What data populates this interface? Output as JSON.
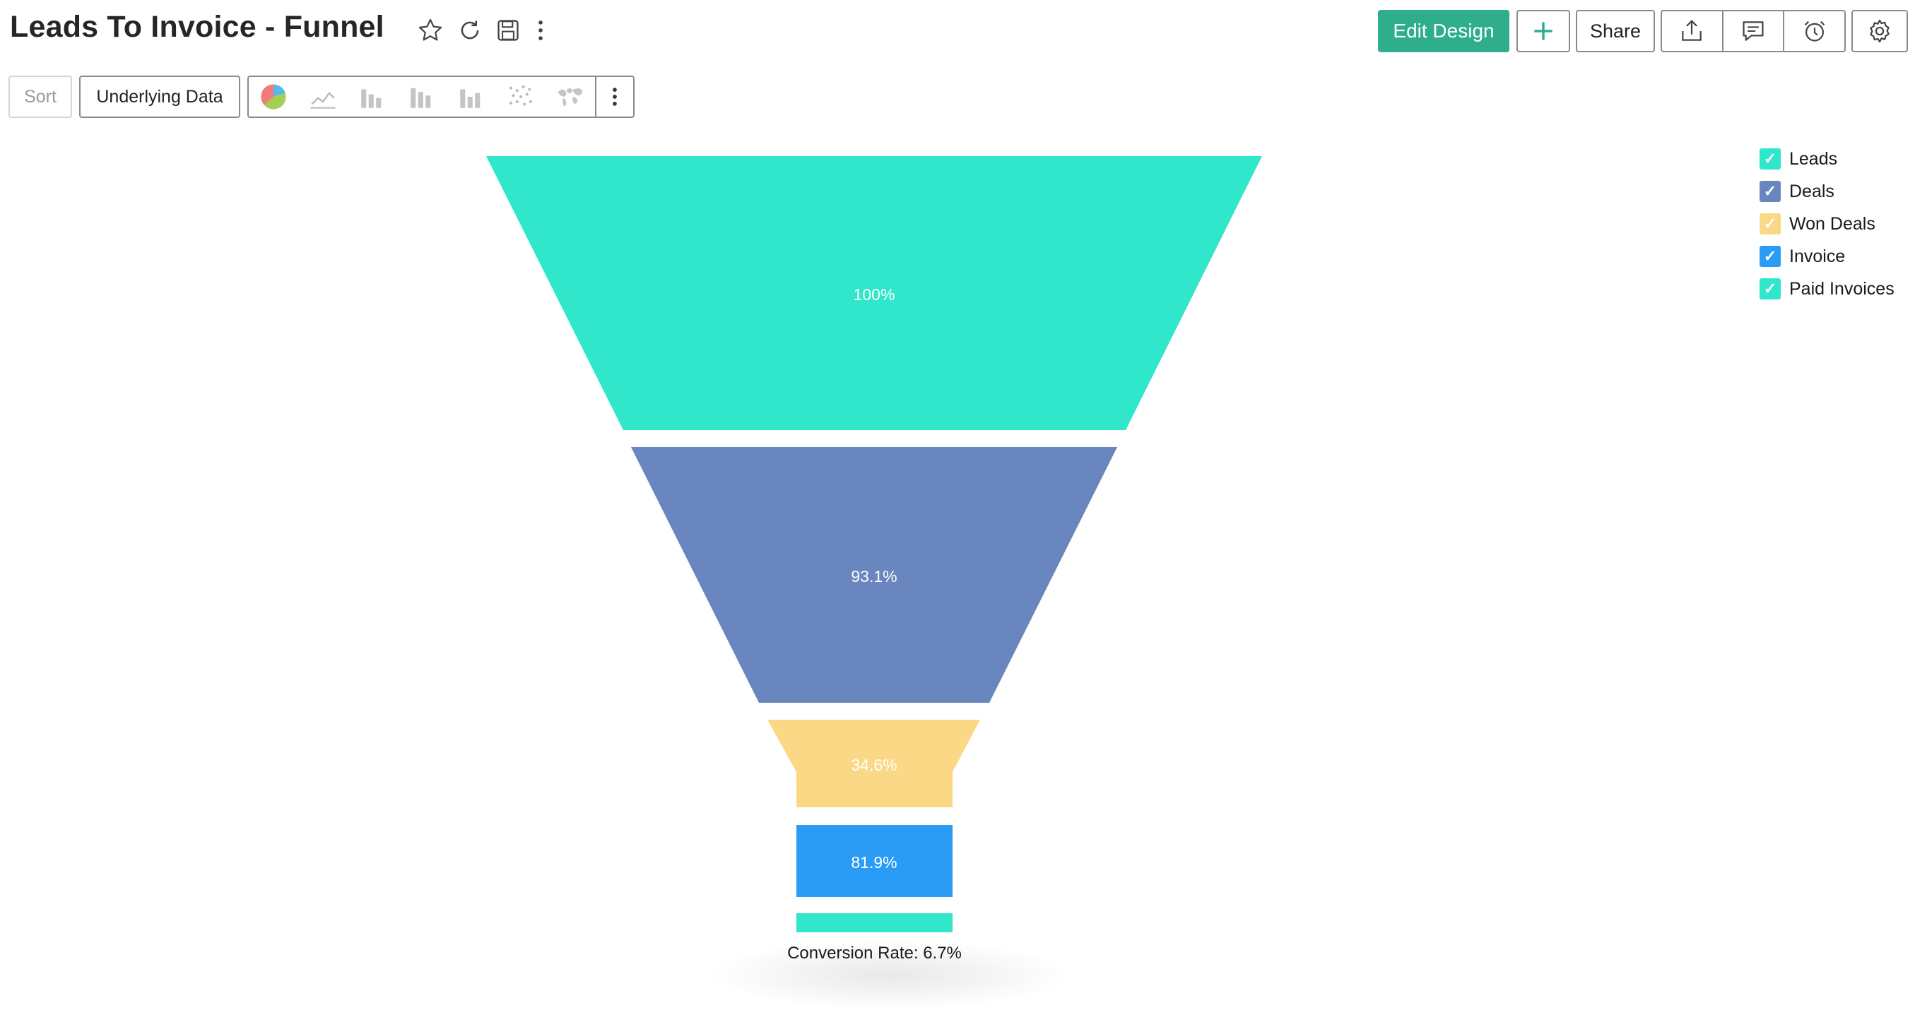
{
  "header": {
    "title": "Leads To Invoice - Funnel",
    "edit_design_label": "Edit Design",
    "share_label": "Share"
  },
  "toolbar": {
    "sort_label": "Sort",
    "underlying_data_label": "Underlying Data",
    "chart_type_icons": [
      "pie-chart-icon",
      "line-chart-icon",
      "bar-chart-icon",
      "stacked-bar-chart-icon",
      "combo-bar-chart-icon",
      "scatter-chart-icon",
      "map-chart-icon"
    ]
  },
  "colors": {
    "accent": "#2fae8e",
    "leads": "#30e6cb",
    "deals": "#6a86bf",
    "won_deals": "#fbd885",
    "invoice": "#2b9cf6",
    "paid_invoices": "#30e6cb"
  },
  "legend": {
    "items": [
      {
        "label": "Leads",
        "color": "#30e6cb",
        "checked": true
      },
      {
        "label": "Deals",
        "color": "#6a86bf",
        "checked": true
      },
      {
        "label": "Won Deals",
        "color": "#fbd885",
        "checked": true
      },
      {
        "label": "Invoice",
        "color": "#2b9cf6",
        "checked": true
      },
      {
        "label": "Paid Invoices",
        "color": "#30e6cb",
        "checked": true
      }
    ]
  },
  "chart_data": {
    "type": "funnel",
    "categories": [
      "Leads",
      "Deals",
      "Won Deals",
      "Invoice",
      "Paid Invoices"
    ],
    "value_labels": [
      "100%",
      "93.1%",
      "34.6%",
      "81.9%",
      ""
    ],
    "footer": "Conversion Rate: 6.7%",
    "legend_position": "top-right"
  }
}
